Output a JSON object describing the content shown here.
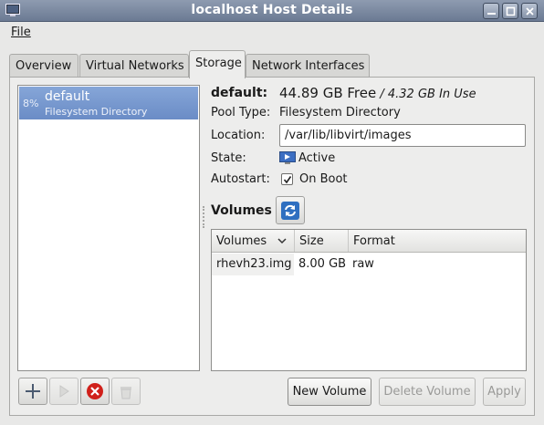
{
  "window": {
    "title": "localhost Host Details"
  },
  "menu": {
    "file": "File"
  },
  "tabs": [
    {
      "label": "Overview",
      "active": false
    },
    {
      "label": "Virtual Networks",
      "active": false
    },
    {
      "label": "Storage",
      "active": true
    },
    {
      "label": "Network Interfaces",
      "active": false
    }
  ],
  "pools": [
    {
      "usage": "8%",
      "name": "default",
      "type": "Filesystem Directory",
      "selected": true
    }
  ],
  "details": {
    "name": "default:",
    "free": "44.89 GB Free",
    "in_use": " / 4.32 GB In Use",
    "pool_type_label": "Pool Type:",
    "pool_type_value": "Filesystem Directory",
    "location_label": "Location:",
    "location_value": "/var/lib/libvirt/images",
    "state_label": "State:",
    "state_value": "Active",
    "autostart_label": "Autostart:",
    "autostart_value": "On Boot",
    "autostart_checked": true
  },
  "volumes": {
    "heading": "Volumes",
    "columns": [
      "Volumes",
      "Size",
      "Format"
    ],
    "rows": [
      {
        "name": "rhevh23.img",
        "size": "8.00 GB",
        "format": "raw"
      }
    ]
  },
  "buttons": {
    "new_volume": "New Volume",
    "delete_volume": "Delete Volume",
    "apply": "Apply"
  },
  "icons": {
    "add_pool": "plus-icon",
    "start_pool": "play-icon",
    "stop_pool": "stop-icon",
    "delete_pool": "trash-icon",
    "refresh": "refresh-icon",
    "state": "monitor-icon"
  },
  "colors": {
    "selection": "#6a8cc6",
    "titlebar": "#7584a0",
    "stop_red": "#d0201a"
  }
}
